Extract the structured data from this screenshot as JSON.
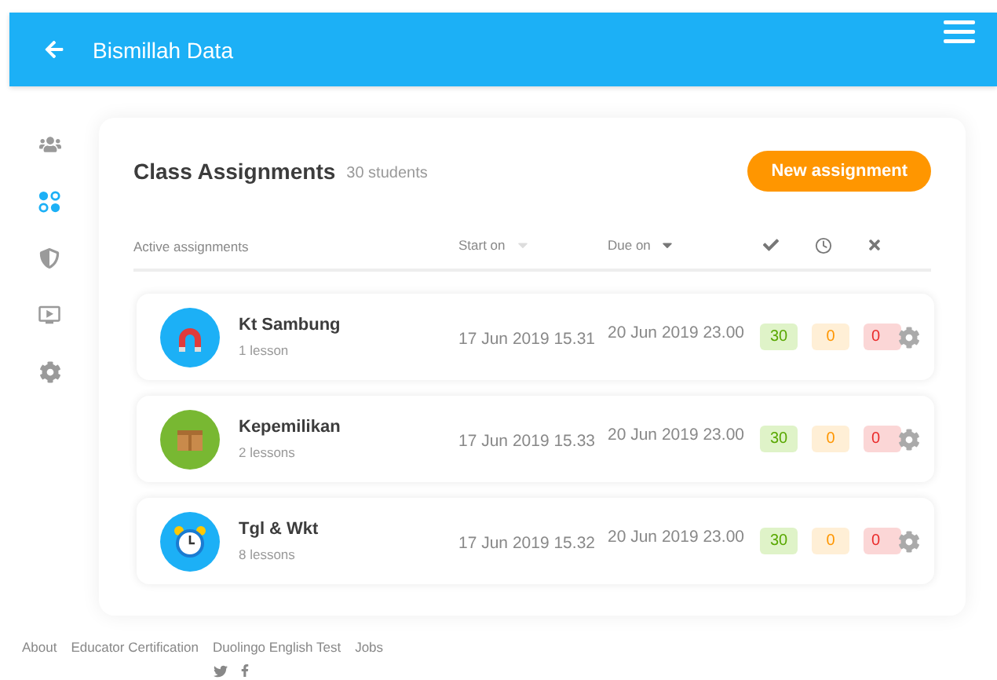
{
  "header": {
    "title": "Bismillah Data"
  },
  "sidebar": {
    "items": [
      {
        "kind": "students",
        "selected": false
      },
      {
        "kind": "assignments",
        "selected": true
      },
      {
        "kind": "badge",
        "selected": false
      },
      {
        "kind": "videos",
        "selected": false
      },
      {
        "kind": "settings",
        "selected": false
      }
    ]
  },
  "panel": {
    "title": "Class Assignments",
    "subtitle": "30 students",
    "new_button": "New assignment"
  },
  "columns": [
    {
      "kind": "text",
      "label": "Active assignments"
    },
    {
      "kind": "sort",
      "label": "Start on",
      "sorted": false
    },
    {
      "kind": "sort",
      "label": "Due on",
      "sorted": true
    },
    {
      "kind": "completed"
    },
    {
      "kind": "pending"
    },
    {
      "kind": "missed"
    }
  ],
  "assignments": [
    {
      "kind": "magnet",
      "color": "#1cb0f6",
      "name": "Kt Sambung",
      "lessons": "1 lesson",
      "start": "17 Jun 2019 15.31",
      "due": "20 Jun 2019 23.00",
      "completed": "30",
      "pending": "0",
      "missed": "0"
    },
    {
      "kind": "box",
      "color": "#78b832",
      "name": "Kepemilikan",
      "lessons": "2 lessons",
      "start": "17 Jun 2019 15.33",
      "due": "20 Jun 2019 23.00",
      "completed": "30",
      "pending": "0",
      "missed": "0"
    },
    {
      "kind": "alarm",
      "color": "#1cb0f6",
      "name": "Tgl & Wkt",
      "lessons": "8 lessons",
      "start": "17 Jun 2019 15.32",
      "due": "20 Jun 2019 23.00",
      "completed": "30",
      "pending": "0",
      "missed": "0"
    }
  ],
  "footer": {
    "links": [
      "About",
      "Educator Certification",
      "Duolingo English Test",
      "Jobs"
    ]
  }
}
